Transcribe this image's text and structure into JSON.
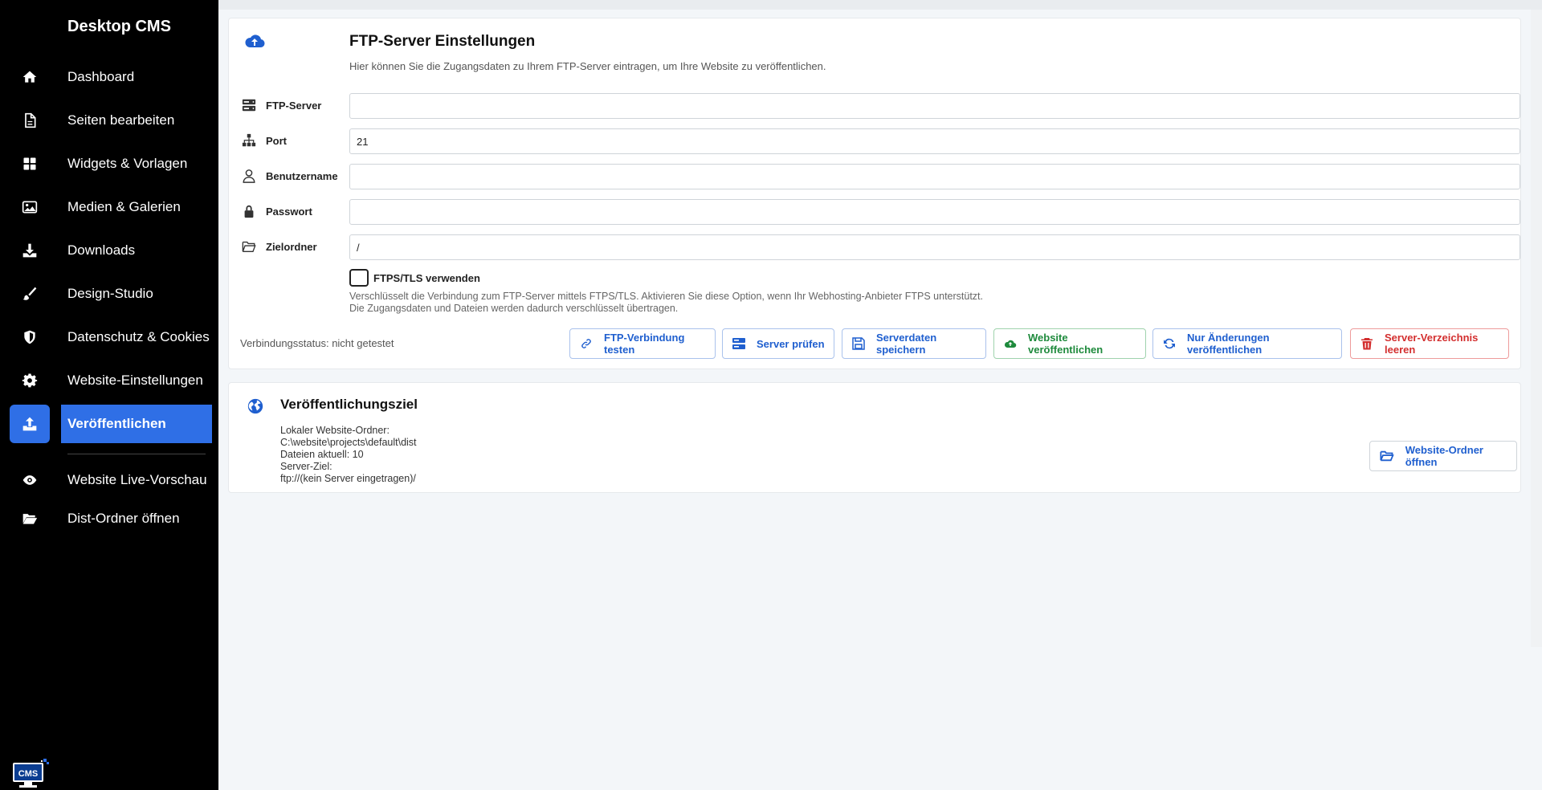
{
  "sidebar": {
    "brand": "Desktop CMS",
    "items": [
      {
        "label": "Dashboard",
        "icon": "home-icon"
      },
      {
        "label": "Seiten bearbeiten",
        "icon": "file-icon"
      },
      {
        "label": "Widgets & Vorlagen",
        "icon": "grid-icon"
      },
      {
        "label": "Medien & Galerien",
        "icon": "image-icon"
      },
      {
        "label": "Downloads",
        "icon": "download-icon"
      },
      {
        "label": "Design-Studio",
        "icon": "brush-icon"
      },
      {
        "label": "Datenschutz & Cookies",
        "icon": "shield-icon"
      },
      {
        "label": "Website-Einstellungen",
        "icon": "gear-icon"
      },
      {
        "label": "Veröffentlichen",
        "icon": "upload-icon",
        "active": true
      },
      {
        "label": "Website Live-Vorschau",
        "icon": "eye-icon"
      },
      {
        "label": "Dist-Ordner öffnen",
        "icon": "folder-open-icon"
      }
    ],
    "logo_text": "CMS"
  },
  "ftp": {
    "title": "FTP-Server Einstellungen",
    "subtitle": "Hier können Sie die Zugangsdaten zu Ihrem FTP-Server eintragen, um Ihre Website zu veröffentlichen.",
    "fields": [
      {
        "label": "FTP-Server",
        "value": "",
        "icon": "server-icon"
      },
      {
        "label": "Port",
        "value": "21",
        "icon": "sitemap-icon"
      },
      {
        "label": "Benutzername",
        "value": "",
        "icon": "user-icon"
      },
      {
        "label": "Passwort",
        "value": "",
        "icon": "lock-icon"
      },
      {
        "label": "Zielordner",
        "value": "/",
        "icon": "folder-icon"
      }
    ],
    "tls_label": "FTPS/TLS verwenden",
    "tls_checked": false,
    "tls_help_1": "Verschlüsselt die Verbindung zum FTP-Server mittels FTPS/TLS. Aktivieren Sie diese Option, wenn Ihr Webhosting-Anbieter FTPS unterstützt.",
    "tls_help_2": "Die Zugangsdaten und Dateien werden dadurch verschlüsselt übertragen.",
    "status": "Verbindungsstatus: nicht getestet",
    "buttons": {
      "test": "FTP-Verbindung testen",
      "check": "Server prüfen",
      "save": "Serverdaten speichern",
      "publish": "Website veröffentlichen",
      "publish_changes": "Nur Änderungen veröffentlichen",
      "clear": "Server-Verzeichnis leeren"
    },
    "colors": {
      "primary": "#1f5fcf",
      "success": "#1e8a3c",
      "danger": "#d32f2f",
      "active_nav": "#2f6fe6"
    }
  },
  "target": {
    "title": "Veröffentlichungsziel",
    "local_label": "Lokaler Website-Ordner:",
    "local_path": "C:\\website\\projects\\default\\dist",
    "files_count": "Dateien aktuell: 10",
    "server_label": "Server-Ziel:",
    "server_path": "ftp://(kein Server eingetragen)/",
    "open_button": "Website-Ordner öffnen"
  }
}
